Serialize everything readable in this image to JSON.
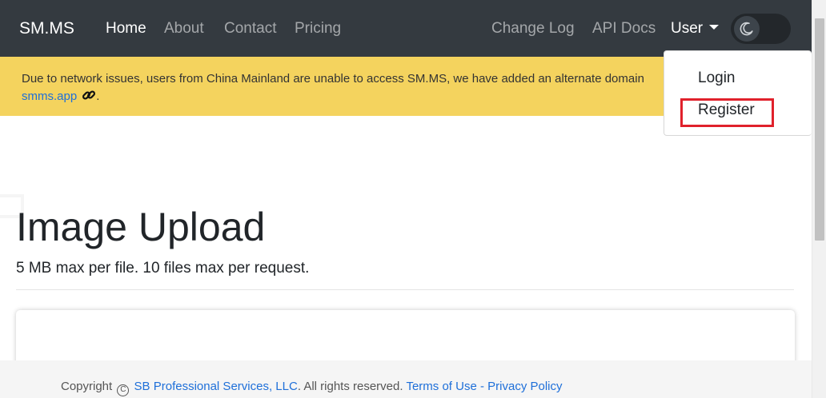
{
  "navbar": {
    "brand": "SM.MS",
    "links": [
      {
        "label": "Home"
      },
      {
        "label": "About"
      },
      {
        "label": "Contact"
      },
      {
        "label": "Pricing"
      }
    ],
    "right_links": [
      {
        "label": "Change Log"
      },
      {
        "label": "API Docs"
      }
    ],
    "user_label": "User",
    "theme_icon": "moon-icon"
  },
  "alert": {
    "text": "Due to network issues, users from China Mainland are unable to access SM.MS, we have added an alternate domain",
    "link_text": "smms.app",
    "link_icon": "link-icon",
    "suffix": "."
  },
  "dropdown": {
    "items": [
      {
        "label": "Login"
      },
      {
        "label": "Register"
      }
    ],
    "highlight_color": "#e0212b"
  },
  "main": {
    "title": "Image Upload",
    "subtitle": "5 MB max per file. 10 files max per request."
  },
  "footer": {
    "prefix": "Copyright",
    "copyright_symbol": "C",
    "company": "SB Professional Services, LLC",
    "rights": ". All rights reserved.",
    "terms": "Terms of Use",
    "separator": " - ",
    "privacy": "Privacy Policy"
  },
  "colors": {
    "navbar_bg": "#343a40",
    "alert_bg": "#f4d35e",
    "link": "#1e6fd9"
  }
}
